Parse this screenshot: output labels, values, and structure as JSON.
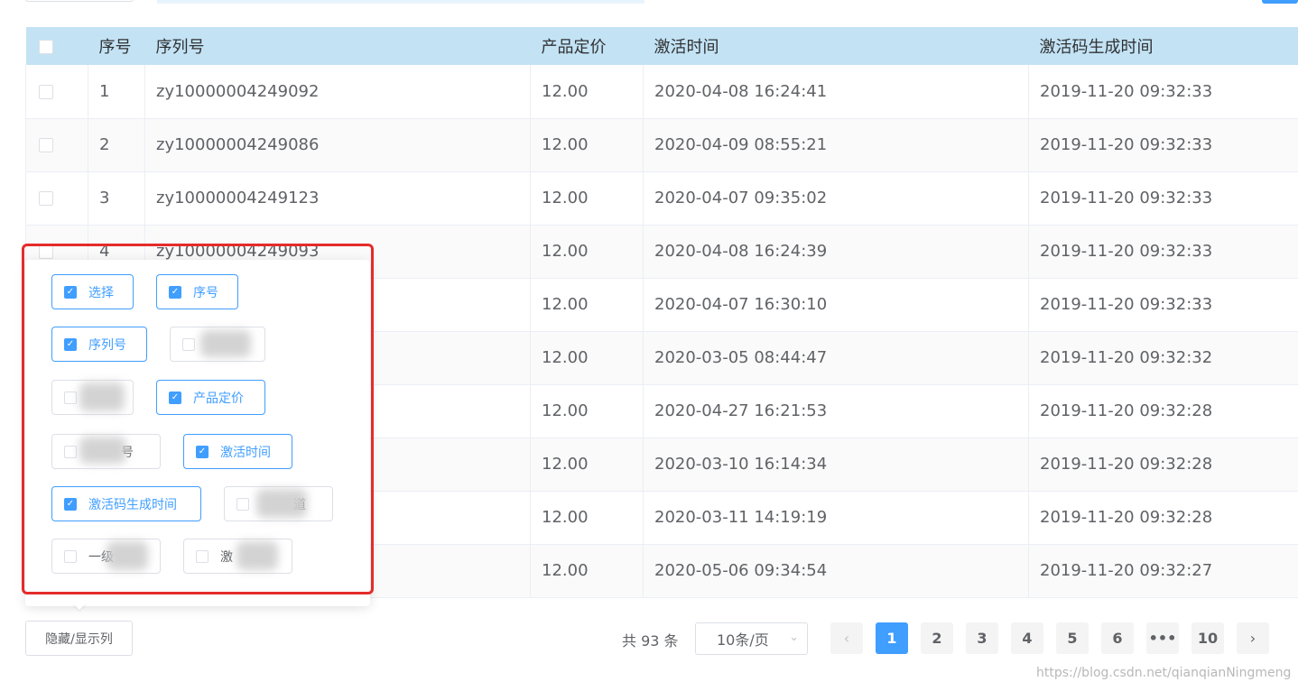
{
  "table": {
    "headers": [
      "序号",
      "序列号",
      "产品定价",
      "激活时间",
      "激活码生成时间"
    ],
    "rows": [
      {
        "index": "1",
        "serial": "zy10000004249092",
        "price": "12.00",
        "activated": "2020-04-08 16:24:41",
        "generated": "2019-11-20 09:32:33"
      },
      {
        "index": "2",
        "serial": "zy10000004249086",
        "price": "12.00",
        "activated": "2020-04-09 08:55:21",
        "generated": "2019-11-20 09:32:33"
      },
      {
        "index": "3",
        "serial": "zy10000004249123",
        "price": "12.00",
        "activated": "2020-04-07 09:35:02",
        "generated": "2019-11-20 09:32:33"
      },
      {
        "index": "4",
        "serial": "zy10000004249093",
        "price": "12.00",
        "activated": "2020-04-08 16:24:39",
        "generated": "2019-11-20 09:32:33"
      },
      {
        "index": "",
        "serial": "",
        "price": "12.00",
        "activated": "2020-04-07 16:30:10",
        "generated": "2019-11-20 09:32:33"
      },
      {
        "index": "",
        "serial": "",
        "price": "12.00",
        "activated": "2020-03-05 08:44:47",
        "generated": "2019-11-20 09:32:32"
      },
      {
        "index": "",
        "serial": "",
        "price": "12.00",
        "activated": "2020-04-27 16:21:53",
        "generated": "2019-11-20 09:32:28"
      },
      {
        "index": "",
        "serial": "",
        "price": "12.00",
        "activated": "2020-03-10 16:14:34",
        "generated": "2019-11-20 09:32:28"
      },
      {
        "index": "",
        "serial": "",
        "price": "12.00",
        "activated": "2020-03-11 14:19:19",
        "generated": "2019-11-20 09:32:28"
      },
      {
        "index": "",
        "serial": "",
        "price": "12.00",
        "activated": "2020-05-06 09:34:54",
        "generated": "2019-11-20 09:32:27"
      }
    ]
  },
  "column_picker": {
    "options": [
      {
        "label": "选择",
        "checked": true
      },
      {
        "label": "序号",
        "checked": true
      },
      {
        "label": "序列号",
        "checked": true
      },
      {
        "label": "",
        "checked": false
      },
      {
        "label": "",
        "checked": false
      },
      {
        "label": "产品定价",
        "checked": true
      },
      {
        "label": "号",
        "checked": false
      },
      {
        "label": "激活时间",
        "checked": true
      },
      {
        "label": "激活码生成时间",
        "checked": true
      },
      {
        "label": "道",
        "checked": false
      },
      {
        "label": "一级",
        "checked": false
      },
      {
        "label": "激",
        "checked": false
      }
    ]
  },
  "footer": {
    "toggle_label": "隐藏/显示列",
    "total_text": "共 93 条",
    "page_size": "10条/页",
    "pages": [
      "1",
      "2",
      "3",
      "4",
      "5",
      "6",
      "•••",
      "10"
    ],
    "current_page": "1"
  },
  "watermark": "https://blog.csdn.net/qianqianNingmeng",
  "colors": {
    "accent": "#409eff",
    "header_bg": "#c3e3f5",
    "highlight_frame": "#e52b2b"
  }
}
